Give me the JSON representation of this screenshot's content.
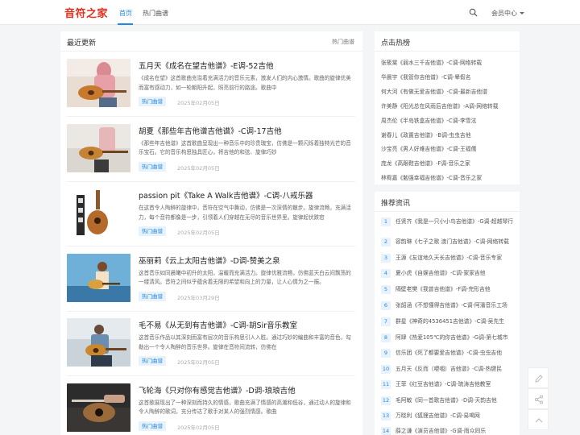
{
  "header": {
    "logo": "音符之家",
    "nav": [
      {
        "label": "首页"
      },
      {
        "label": "热门曲谱"
      }
    ],
    "user_menu": "会员中心"
  },
  "main": {
    "title": "最近更新",
    "more": "热门曲谱",
    "articles": [
      {
        "title": "五月天《成名在望吉他谱》-E调-52吉他",
        "desc": "《成名在望》这首歌曲充溢着充满活力的音乐元素，激发人们的内心激情。歌曲的旋律优美而富有感动力，如一轮朝阳升起，照亮前行的路途。歌曲中",
        "tag": "热门曲谱",
        "date": "2025年02月05日",
        "scene": "a"
      },
      {
        "title": "胡夏《那些年吉他谱吉他谱》-C调-17吉他",
        "desc": "《那些年吉他谱》这首歌曲呈现出一种音乐中的珍贵瑰宝，仿佛是一颗闪烁着独特光芒的音乐宝石。它的音乐构思独具匠心，将吉他的和弦、旋律巧妙",
        "tag": "热门曲谱",
        "date": "2025年02月05日",
        "scene": "b"
      },
      {
        "title": "passion pit《Take A Walk吉他谱》-C调-八戒乐器",
        "desc": "在这首令人陶醉的旋律中，音符在空气中舞动，仿佛是一次深情的散步。旋律流畅，充满活力，每个音符都像是一步，引领着人们穿越在无尽的音乐世界里。旋律起伏跌宕",
        "tag": "热门曲谱",
        "date": "2025年02月05日",
        "scene": "c"
      },
      {
        "title": "巫丽莉《云上太阳吉他谱》-D调-赞美之泉",
        "desc": "这首音乐如同晨曦中初升的太阳，温暖而充满活力。旋律优雅流畅，仿佛蓝天白云间飘荡的一缕清风。音符之间似乎蕴含着无限的希望和向上的力量，让人心情为之一振。",
        "tag": "热门曲谱",
        "date": "2025年03月29日",
        "scene": "d"
      },
      {
        "title": "毛不易《从无到有吉他谱》-C调-胡Sir音乐教室",
        "desc": "这首音乐作品以其深刻而富有层次的音乐构思引人入胜。通过巧妙的编曲和丰富的音色，勾勒出一个令人陶醉的音乐世界。旋律在音符间流转，仿佛在",
        "tag": "热门曲谱",
        "date": "2025年02月05日",
        "scene": "e"
      },
      {
        "title": "飞轮海《只对你有感觉吉他谱》-D调-琅琅吉他",
        "desc": "这首歌展现出了一种深刻而持久的情感，歌曲充满了情感的高潮和低谷，通过动人的旋律和令人陶醉的歌词，充分传达了歌手对某人的强烈情感。歌曲",
        "tag": "热门曲谱",
        "date": "2025年02月05日",
        "scene": "f"
      }
    ]
  },
  "hot": {
    "title": "点击热榜",
    "items": [
      "张筱棠《弱水三千吉他谱》-C调-网络转载",
      "华晨宇《我管你吉他谱》-C调-晕假名",
      "何大河《有做无爱吉他谱》-C调-最新吉他谱",
      "许美静《阳光总在风雨后吉他谱》-A调-网络转载",
      "周杰伦《半岛铁盒吉他谱》-C调-李雪泫",
      "谢春儿《政置吉他谱》-B调-虫虫吉他",
      "沙宝亮《男人好难吉他谱》-C调-王福儒",
      "庞龙《高跟鞋吉他谱》-F调-音乐之家",
      "林宥嘉《勉强幸福吉他谱》-C调-音乐之家"
    ]
  },
  "recommend": {
    "title": "推荐资讯",
    "items": [
      {
        "num": "1",
        "text": "任贤齐《我是一只小小鸟吉他谱》-G调-超越琴行"
      },
      {
        "num": "2",
        "text": "容韵琳《七子之歌 澳门吉他谱》-C调-网络转载"
      },
      {
        "num": "3",
        "text": "王源《友谊地久天长吉他谱》-C调-音乐专家"
      },
      {
        "num": "4",
        "text": "夏小虎《自娱吉他谱》-C调-家家吉他"
      },
      {
        "num": "5",
        "text": "隔壁老樊《我曾吉他谱》-F调-完形吉他"
      },
      {
        "num": "6",
        "text": "张韶涵《不想懂得吉他谱》-C调-阿潘音乐工场"
      },
      {
        "num": "7",
        "text": "群星《神奇的4536451吉他谱》-C调-吴先生"
      },
      {
        "num": "8",
        "text": "阿肆《热爱105℃的你吉他谱》-G调-第七城市"
      },
      {
        "num": "9",
        "text": "信乐团《死了都要爱吉他谱》-C调-虫虫吉他"
      },
      {
        "num": "10",
        "text": "五月天《反而（哽咽）吉他谱》-C调-热健民"
      },
      {
        "num": "11",
        "text": "王菲《红豆吉他谱》-C调-琉涛吉他教室"
      },
      {
        "num": "12",
        "text": "毛阿敏《同一首歌吉他谱》-D调-天韵吉他"
      },
      {
        "num": "13",
        "text": "万晓利《狐狸吉他谱》-C调-易喝网"
      },
      {
        "num": "14",
        "text": "薛之谦《演员吉他谱》-G调-雨众同乐"
      }
    ]
  },
  "colors": {
    "brand": "#e0301e",
    "accent": "#1e88e5"
  },
  "icons": {
    "search": "search-icon",
    "edit": "pencil-icon",
    "share": "share-icon",
    "top": "back-to-top-icon"
  }
}
